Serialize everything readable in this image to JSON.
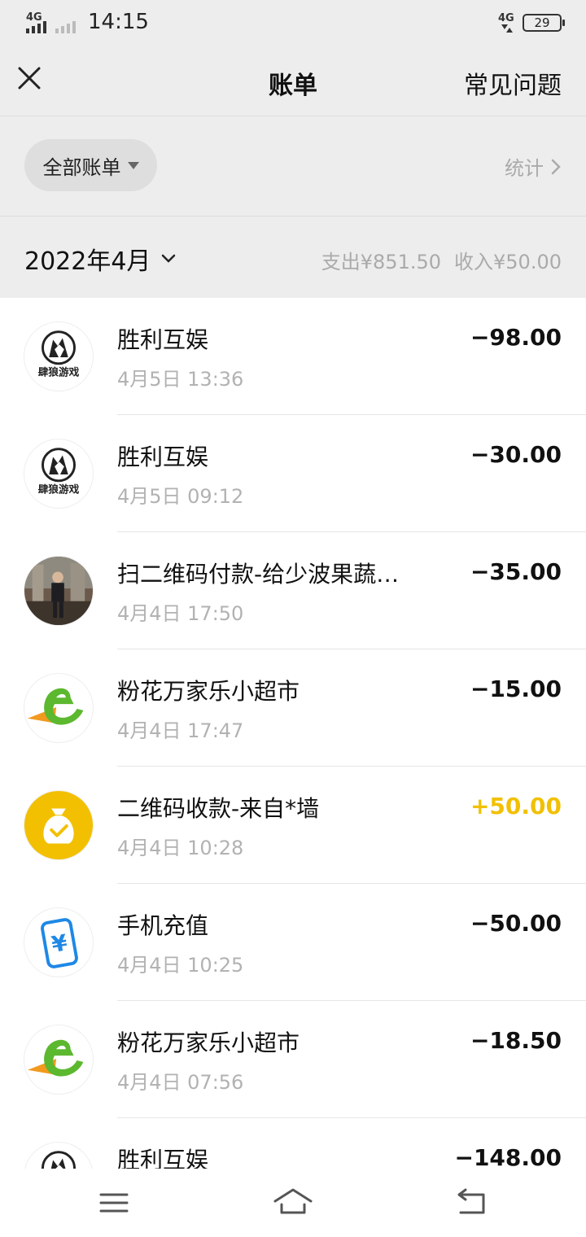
{
  "status_bar": {
    "network_left": "4G",
    "time": "14:15",
    "network_right": "4G",
    "battery": "29"
  },
  "header": {
    "title": "账单",
    "faq_label": "常见问题"
  },
  "filter": {
    "label": "全部账单",
    "stats_label": "统计"
  },
  "month": {
    "label": "2022年4月",
    "expense": "支出¥851.50",
    "income": "收入¥50.00"
  },
  "transactions": [
    {
      "name": "胜利互娱",
      "time": "4月5日 13:36",
      "amount": "−98.00",
      "type": "expense",
      "icon": "wolf-game-icon",
      "icon_text": "肆狼游戏"
    },
    {
      "name": "胜利互娱",
      "time": "4月5日 09:12",
      "amount": "−30.00",
      "type": "expense",
      "icon": "wolf-game-icon",
      "icon_text": "肆狼游戏"
    },
    {
      "name": "扫二维码付款-给少波果蔬…",
      "time": "4月4日 17:50",
      "amount": "−35.00",
      "type": "expense",
      "icon": "user-photo-avatar"
    },
    {
      "name": "粉花万家乐小超市",
      "time": "4月4日 17:47",
      "amount": "−15.00",
      "type": "expense",
      "icon": "e-store-logo-icon"
    },
    {
      "name": "二维码收款-来自*墙",
      "time": "4月4日 10:28",
      "amount": "+50.00",
      "type": "income",
      "icon": "money-bag-icon"
    },
    {
      "name": "手机充值",
      "time": "4月4日 10:25",
      "amount": "−50.00",
      "type": "expense",
      "icon": "phone-recharge-icon"
    },
    {
      "name": "粉花万家乐小超市",
      "time": "4月4日 07:56",
      "amount": "−18.50",
      "type": "expense",
      "icon": "e-store-logo-icon"
    },
    {
      "name": "胜利互娱",
      "time": "",
      "amount": "−148.00",
      "type": "expense",
      "icon": "wolf-game-icon",
      "icon_text": "肆狼游戏"
    }
  ],
  "colors": {
    "income": "#f2c000",
    "background": "#ededed",
    "list_bg": "#ffffff",
    "muted_text": "#b2b2b2"
  },
  "nav": {
    "menu_icon": "menu-icon",
    "home_icon": "home-icon",
    "back_icon": "back-icon"
  }
}
